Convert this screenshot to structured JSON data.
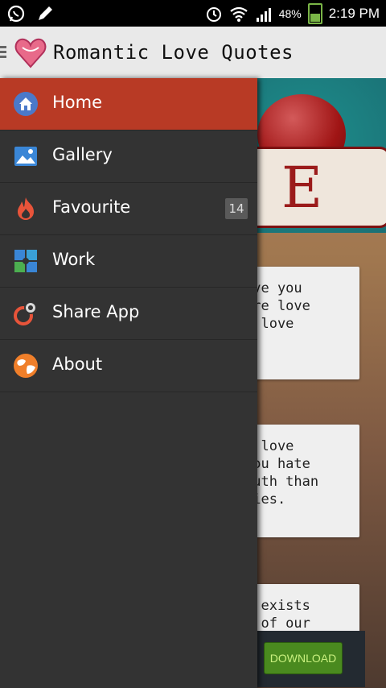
{
  "status_bar": {
    "battery_percent": "48%",
    "time": "2:19 PM",
    "left_icons": [
      "whatsapp-icon",
      "pencil-icon"
    ],
    "right_icons": [
      "alarm-icon",
      "wifi-icon",
      "signal-icon",
      "battery-icon"
    ]
  },
  "app_bar": {
    "title": "Romantic Love Quotes"
  },
  "drawer": {
    "items": [
      {
        "label": "Home",
        "icon": "home-icon",
        "active": true
      },
      {
        "label": "Gallery",
        "icon": "gallery-icon",
        "active": false
      },
      {
        "label": "Favourite",
        "icon": "flame-icon",
        "active": false,
        "count": "14"
      },
      {
        "label": "Work",
        "icon": "puzzle-icon",
        "active": false
      },
      {
        "label": "Share App",
        "icon": "share-icon",
        "active": false
      },
      {
        "label": "About",
        "icon": "globe-icon",
        "active": false
      }
    ]
  },
  "content": {
    "banner_letter": "E",
    "cards": [
      {
        "lines": [
          "ove you",
          "ure love",
          " I love"
        ]
      },
      {
        "lines": [
          "I love",
          " you hate",
          "ruth than",
          " lies."
        ]
      },
      {
        "lines": [
          "y exists",
          "t of our"
        ]
      }
    ],
    "ad": {
      "button_label": "DOWNLOAD"
    }
  },
  "colors": {
    "drawer_bg": "#333333",
    "active_item": "#b83a25",
    "app_bar_bg": "#e9e9e9",
    "status_bar_bg": "#000000"
  }
}
